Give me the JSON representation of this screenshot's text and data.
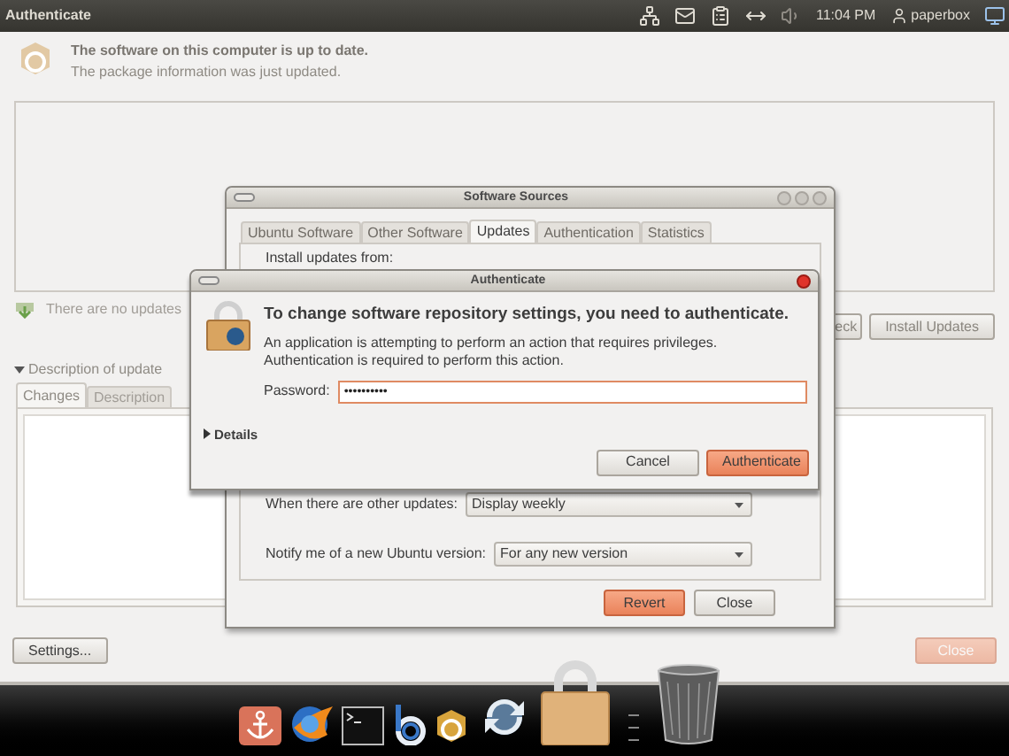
{
  "top_panel": {
    "title": "Authenticate",
    "clock": "11:04 PM",
    "user": "paperbox"
  },
  "update_manager": {
    "heading": "The software on this computer is up to date.",
    "subheading": "The package information was just updated.",
    "status": "There are no updates",
    "action_buttons": [
      {
        "label": "eck",
        "disabled": true
      },
      {
        "label": "Install Updates",
        "disabled": true
      }
    ],
    "description": {
      "label": "Description of update",
      "expanded": true
    },
    "tabs": [
      {
        "label": "Changes",
        "selected": true
      },
      {
        "label": "Description",
        "selected": false
      }
    ],
    "footer_buttons": [
      {
        "label": "Settings...",
        "kind": "normal",
        "disabled": false
      },
      {
        "label": "Close",
        "kind": "suggested",
        "disabled": true
      }
    ]
  },
  "software_sources": {
    "title": "Software Sources",
    "tabs": [
      {
        "label": "Ubuntu Software",
        "selected": false
      },
      {
        "label": "Other Software",
        "selected": false
      },
      {
        "label": "Updates",
        "selected": true
      },
      {
        "label": "Authentication",
        "selected": false
      },
      {
        "label": "Statistics",
        "selected": false
      }
    ],
    "install_label": "Install updates from:",
    "rows": [
      {
        "label": "When there are other updates:",
        "value": "Display weekly"
      },
      {
        "label": "Notify me of a new Ubuntu version:",
        "value": "For any new version"
      }
    ],
    "buttons": [
      {
        "label": "Revert",
        "kind": "suggested",
        "disabled": false
      },
      {
        "label": "Close",
        "kind": "normal",
        "disabled": false
      }
    ]
  },
  "auth_dialog": {
    "title": "Authenticate",
    "heading": "To change software repository settings, you need to authenticate.",
    "message_lines": [
      "An application is attempting to perform an action that requires privileges.",
      "Authentication is required to perform this action."
    ],
    "password_label": "Password:",
    "password_value": "••••••••••",
    "details": {
      "label": "Details",
      "expanded": false
    },
    "buttons": [
      {
        "label": "Cancel",
        "kind": "normal",
        "disabled": false
      },
      {
        "label": "Authenticate",
        "kind": "suggested",
        "disabled": false
      }
    ]
  },
  "dock": {
    "items": [
      {
        "kind": "anchor"
      },
      {
        "kind": "browser"
      },
      {
        "kind": "terminal"
      },
      {
        "kind": "b"
      },
      {
        "kind": "package"
      },
      {
        "kind": "sync"
      },
      {
        "kind": "lock"
      },
      {
        "kind": "trash"
      }
    ]
  }
}
